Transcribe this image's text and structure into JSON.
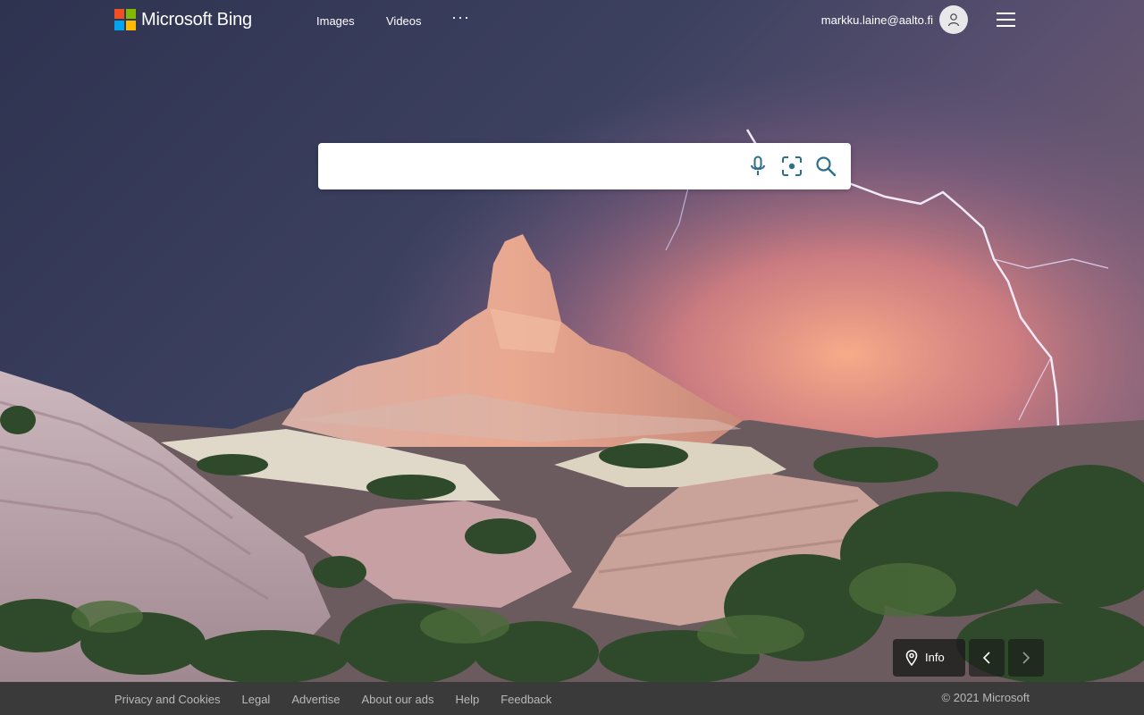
{
  "colors": {
    "logo_red": "#f25022",
    "logo_green": "#7fba00",
    "logo_blue": "#00a4ef",
    "logo_yellow": "#ffb900",
    "search_icon": "#2b6f8b",
    "footer_bg": "#3a3a3a",
    "footer_text": "#b9b9b9"
  },
  "header": {
    "brand": "Microsoft Bing",
    "nav": [
      "Images",
      "Videos"
    ],
    "more_label": "···",
    "account_email": "markku.laine@aalto.fi"
  },
  "search": {
    "value": "",
    "icons": [
      "microphone-icon",
      "visual-search-icon",
      "search-icon"
    ]
  },
  "image_controls": {
    "info_label": "Info",
    "icons": [
      "location-pin-icon",
      "chevron-left-icon",
      "chevron-right-icon"
    ]
  },
  "footer": {
    "links": [
      "Privacy and Cookies",
      "Legal",
      "Advertise",
      "About our ads",
      "Help",
      "Feedback"
    ],
    "copyright": "© 2021 Microsoft"
  }
}
